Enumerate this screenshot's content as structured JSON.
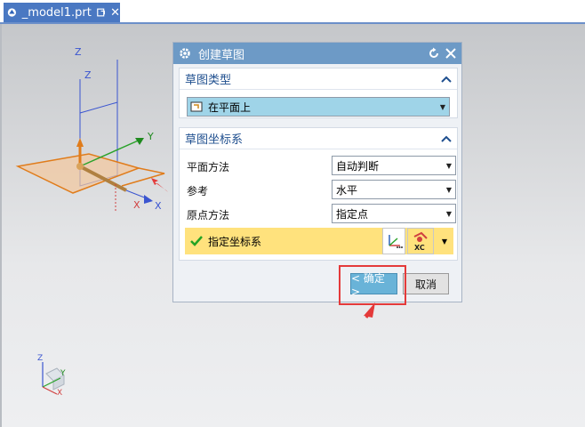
{
  "tab": {
    "title": "_model1.prt",
    "close": "✕"
  },
  "dialog": {
    "title": "创建草图",
    "sketch_type": {
      "header": "草图类型",
      "selected": "在平面上"
    },
    "sketch_csys": {
      "header": "草图坐标系",
      "rows": [
        {
          "label": "平面方法",
          "value": "自动判断"
        },
        {
          "label": "参考",
          "value": "水平"
        },
        {
          "label": "原点方法",
          "value": "指定点"
        }
      ],
      "specify_csys": "指定坐标系",
      "xc_label": "XC"
    },
    "ok_label": "< 确定 >",
    "cancel_label": "取消"
  },
  "axes": {
    "x": "X",
    "y": "Y",
    "z": "Z"
  },
  "triad": {
    "x": "X",
    "y": "Y",
    "z": "Z"
  },
  "colors": {
    "tab": "#4a78c2",
    "title_bar": "#6d9ac6",
    "highlight": "#e43a3a",
    "ok_button": "#69b3d8"
  }
}
